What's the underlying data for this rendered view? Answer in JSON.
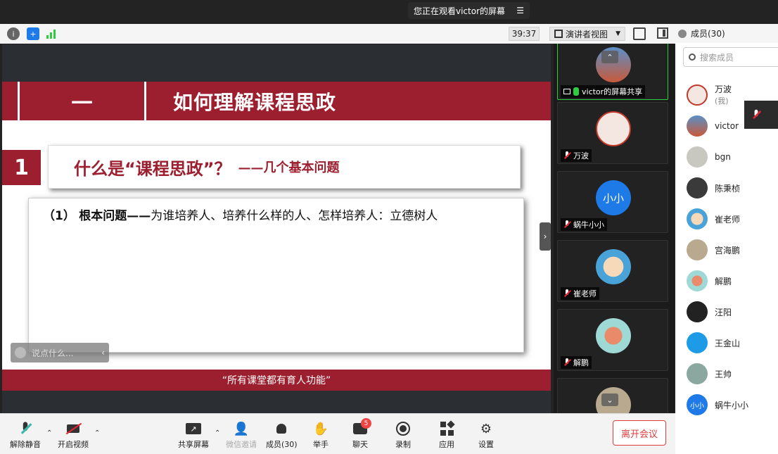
{
  "banner": {
    "text": "您正在观看victor的屏幕"
  },
  "topbar": {
    "timer": "39:37",
    "view_mode": "演讲者视图"
  },
  "slide": {
    "title_num": "一",
    "title": "如何理解课程思政",
    "section_num": "1",
    "section_title": "什么是“课程思政”？",
    "section_sub": "——几个基本问题",
    "content_prefix": "（1）",
    "content_bold": "根本问题——",
    "content_rest": "为谁培养人、培养什么样的人、怎样培养人：立德树人",
    "footer": "“所有课堂都有育人功能”"
  },
  "chat_input": {
    "placeholder": "说点什么..."
  },
  "video_tiles": [
    {
      "name": "victor的屏幕共享",
      "mic": "on"
    },
    {
      "name": "万波",
      "mic": "off"
    },
    {
      "name": "蜗牛小小",
      "mic": "off",
      "initials": "小小"
    },
    {
      "name": "崔老师",
      "mic": "off"
    },
    {
      "name": "解鹏",
      "mic": "off"
    }
  ],
  "members": {
    "header": "成员(30)",
    "search_placeholder": "搜索成员",
    "list": [
      {
        "name": "万波",
        "sub": "(我)"
      },
      {
        "name": "victor"
      },
      {
        "name": "bgn"
      },
      {
        "name": "陈秉桢"
      },
      {
        "name": "崔老师"
      },
      {
        "name": "宫海鹏"
      },
      {
        "name": "解鹏"
      },
      {
        "name": "汪阳"
      },
      {
        "name": "王金山"
      },
      {
        "name": "王帅"
      },
      {
        "name": "蜗牛小小",
        "initials": "小小"
      }
    ]
  },
  "toolbar": {
    "unmute": "解除静音",
    "start_video": "开启视频",
    "share_screen": "共享屏幕",
    "wechat_invite": "微信邀请",
    "members": "成员(30)",
    "raise_hand": "举手",
    "chat": "聊天",
    "chat_badge": "5",
    "record": "录制",
    "apps": "应用",
    "settings": "设置",
    "leave": "离开会议"
  },
  "colors": {
    "accent_red": "#9c1f2f",
    "leave_red": "#e03b3b",
    "avatar_blue": "#1e7ae6"
  }
}
